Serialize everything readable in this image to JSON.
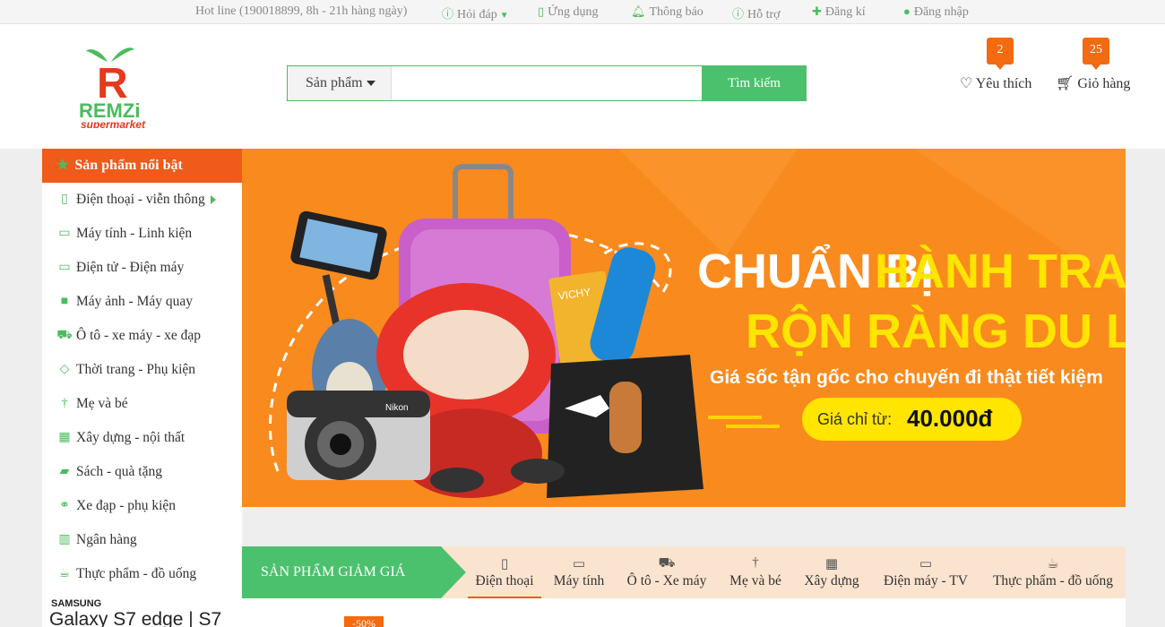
{
  "topbar": {
    "hotline": "Hot line (190018899, 8h - 21h hàng ngày)",
    "faq": "Hỏi đáp",
    "app": "Ứng dụng",
    "notify": "Thông báo",
    "support": "Hỗ trợ",
    "register": "Đăng kí",
    "login": "Đăng nhập"
  },
  "logo": {
    "letter": "R",
    "name": "REMZi",
    "sub": "supermarket"
  },
  "search": {
    "category": "Sản phẩm",
    "placeholder": "",
    "button": "Tìm kiếm"
  },
  "header": {
    "wishlist": "Yêu thích",
    "wishlist_count": "2",
    "cart": "Giỏ hàng",
    "cart_count": "25"
  },
  "sidebar": {
    "title": "Sản phẩm nổi bật",
    "items": [
      {
        "label": "Điện thoại - viễn thông",
        "icon": "phone-icon"
      },
      {
        "label": "Máy tính - Linh kiện",
        "icon": "laptop-icon"
      },
      {
        "label": "Điện tử - Điện máy",
        "icon": "monitor-icon"
      },
      {
        "label": "Máy ảnh - Máy quay",
        "icon": "video-camera-icon"
      },
      {
        "label": "Ô tô - xe máy - xe đạp",
        "icon": "car-icon"
      },
      {
        "label": "Thời trang - Phụ kiện",
        "icon": "diamond-icon"
      },
      {
        "label": "Mẹ và bé",
        "icon": "child-icon"
      },
      {
        "label": "Xây dựng - nội thất",
        "icon": "building-icon"
      },
      {
        "label": "Sách - quà tặng",
        "icon": "book-icon"
      },
      {
        "label": "Xe đạp - phụ kiện",
        "icon": "bicycle-icon"
      },
      {
        "label": "Ngân hàng",
        "icon": "bank-icon"
      },
      {
        "label": "Thực phẩm - đồ uống",
        "icon": "coffee-icon"
      }
    ],
    "ad_brand": "SAMSUNG",
    "ad_model": "Galaxy S7 edge | S7"
  },
  "banner": {
    "line1_white": "CHUẨN BỊ",
    "line1_yellow": "HÀNH TRANG",
    "line2_yellow": "RỘN RÀNG DU LỊCH",
    "subtitle": "Giá sốc tận gốc cho chuyến đi thật tiết kiệm",
    "price_label": "Giá chỉ từ:",
    "price_value": "40.000đ",
    "sunscreen_brand": "VICHY",
    "camera_brand": "Nikon"
  },
  "deals": {
    "title": "SẢN PHẨM GIẢM GIÁ",
    "tabs": [
      {
        "label": "Điện thoại",
        "icon": "phone-icon"
      },
      {
        "label": "Máy tính",
        "icon": "laptop-icon"
      },
      {
        "label": "Ô tô - Xe máy",
        "icon": "car-icon"
      },
      {
        "label": "Mẹ và bé",
        "icon": "child-icon"
      },
      {
        "label": "Xây dựng",
        "icon": "building-icon"
      },
      {
        "label": "Điện máy - TV",
        "icon": "monitor-icon"
      },
      {
        "label": "Thực phẩm - đồ uống",
        "icon": "coffee-icon"
      }
    ],
    "discount_badge": "-50%"
  },
  "colors": {
    "green": "#4cc16d",
    "orange": "#f05a1a",
    "banner": "#f98a1d",
    "yellow": "#ffe500"
  }
}
